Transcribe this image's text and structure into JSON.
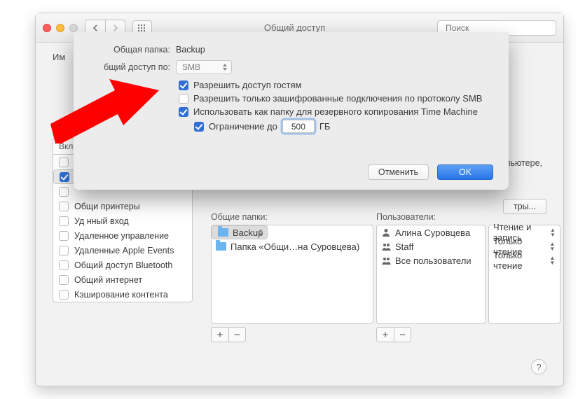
{
  "window": {
    "title": "Общий доступ",
    "search_placeholder": "Поиск"
  },
  "cut_label": "Им",
  "side": {
    "header": "Вкл.",
    "rows": [
      {
        "checked": false,
        "label": "",
        "sel": false
      },
      {
        "checked": true,
        "label": "",
        "sel": true
      },
      {
        "checked": false,
        "label": "",
        "sel": false
      },
      {
        "checked": false,
        "label": "Общи принтеры",
        "sel": false
      },
      {
        "checked": false,
        "label": "Уд      нный вход",
        "sel": false
      },
      {
        "checked": false,
        "label": "Удаленное управление",
        "sel": false
      },
      {
        "checked": false,
        "label": "Удаленные Apple Events",
        "sel": false
      },
      {
        "checked": false,
        "label": "Общий доступ Bluetooth",
        "sel": false
      },
      {
        "checked": false,
        "label": "Общий интернет",
        "sel": false
      },
      {
        "checked": false,
        "label": "Кэширование контента",
        "sel": false
      }
    ]
  },
  "frag": "пьютере,",
  "options_btn": "тры...",
  "columns": {
    "folders": "Общие папки:",
    "users": "Пользователи:"
  },
  "folders": [
    {
      "label": "Backup",
      "sel": true
    },
    {
      "label": "Папка «Общи…на Суровцева)",
      "sel": false
    }
  ],
  "users": [
    {
      "label": "Алина Суровцева",
      "icon": "person"
    },
    {
      "label": "Staff",
      "icon": "people"
    },
    {
      "label": "Все пользователи",
      "icon": "people"
    }
  ],
  "perms": [
    {
      "label": "Чтение и запись"
    },
    {
      "label": "Только чтение"
    },
    {
      "label": "Только чтение"
    }
  ],
  "sheet": {
    "folder_lbl": "Общая папка:",
    "folder_val": "Backup",
    "share_lbl": "бщий доступ по:",
    "share_val": "SMB",
    "opt1": "Разрешить доступ гостям",
    "opt2": "Разрешить только зашифрованные подключения по протоколу SMB",
    "opt3": "Использовать как папку для резервного копирования Time Machine",
    "opt4a": "Ограничение до",
    "opt4_val": "500",
    "opt4b": "ГБ",
    "cancel": "Отменить",
    "ok": "OK"
  }
}
